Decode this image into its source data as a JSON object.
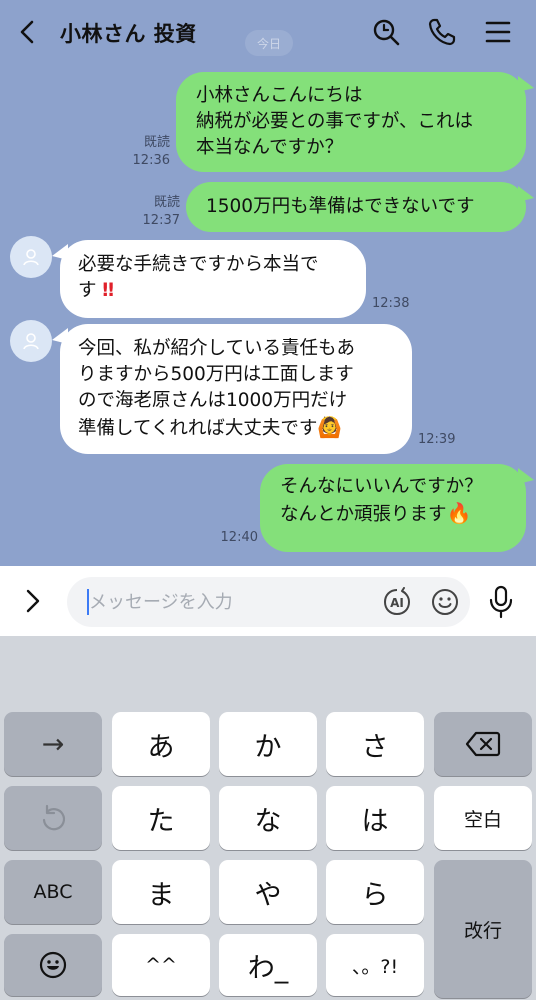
{
  "header": {
    "title": "小林さん 投資",
    "date_chip": "今日"
  },
  "messages": [
    {
      "side": "out",
      "lines": [
        "小林さんこんにちは",
        "納税が必要との事ですが、これは",
        "本当なんですか？"
      ],
      "read": "既読",
      "time": "12:36"
    },
    {
      "side": "out",
      "lines": [
        "1500万円も準備はできないです"
      ],
      "read": "既読",
      "time": "12:37"
    },
    {
      "side": "in",
      "lines": [
        "必要な手続きですから本当で",
        "す"
      ],
      "trailing": "‼",
      "time": "12:38"
    },
    {
      "side": "in",
      "lines": [
        "今回、私が紹介している責任もあ",
        "りますから500万円は工面します",
        "ので海老原さんは1000万円だけ",
        "準備してくれれば大丈夫です"
      ],
      "trailing_emoji": "🙆",
      "time": "12:39"
    },
    {
      "side": "out",
      "lines": [
        "そんなにいいんですか？",
        "なんとか頑張ります"
      ],
      "trailing_emoji": "🔥",
      "time": "12:40"
    }
  ],
  "composer": {
    "placeholder": "メッセージを入力",
    "ai_label": "AI"
  },
  "keyboard": {
    "row1": [
      "→",
      "あ",
      "か",
      "さ",
      "⌫"
    ],
    "row2": [
      "↺",
      "た",
      "な",
      "は",
      "空白"
    ],
    "row3": [
      "ABC",
      "ま",
      "や",
      "ら",
      "改行"
    ],
    "row4": [
      "☻",
      "^^",
      "わ_",
      "、。?!"
    ]
  }
}
